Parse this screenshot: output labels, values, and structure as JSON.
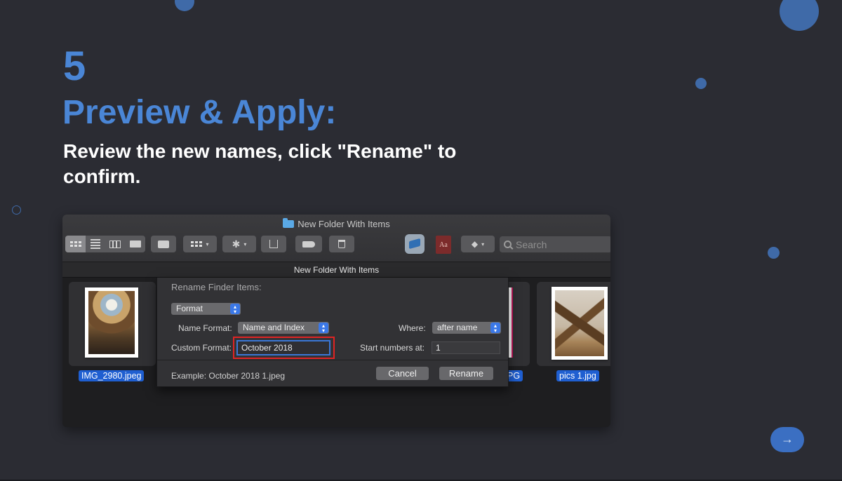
{
  "slide": {
    "step_number": "5",
    "step_title": "Preview & Apply:",
    "step_description": "Review the new names, click \"Rename\" to confirm.",
    "next_arrow": "→"
  },
  "finder": {
    "window_title": "New Folder With Items",
    "path_title": "New Folder With Items",
    "search_placeholder": "Search",
    "dictionary_icon_text": "Aa",
    "files": [
      {
        "name": "IMG_2980.jpeg"
      },
      {
        "name": "PG"
      },
      {
        "name": "pics 1.jpg"
      }
    ]
  },
  "rename_dialog": {
    "title": "Rename Finder Items:",
    "mode": "Format",
    "name_format_label": "Name Format:",
    "name_format_value": "Name and Index",
    "where_label": "Where:",
    "where_value": "after name",
    "custom_format_label": "Custom Format:",
    "custom_format_value": "October 2018",
    "start_numbers_label": "Start numbers at:",
    "start_numbers_value": "1",
    "example": "Example: October 2018 1.jpeg",
    "cancel_label": "Cancel",
    "rename_label": "Rename"
  },
  "colors": {
    "accent": "#4a86d6",
    "background": "#2b2c33",
    "highlight": "#e02424",
    "selection": "#1f5fd1"
  }
}
